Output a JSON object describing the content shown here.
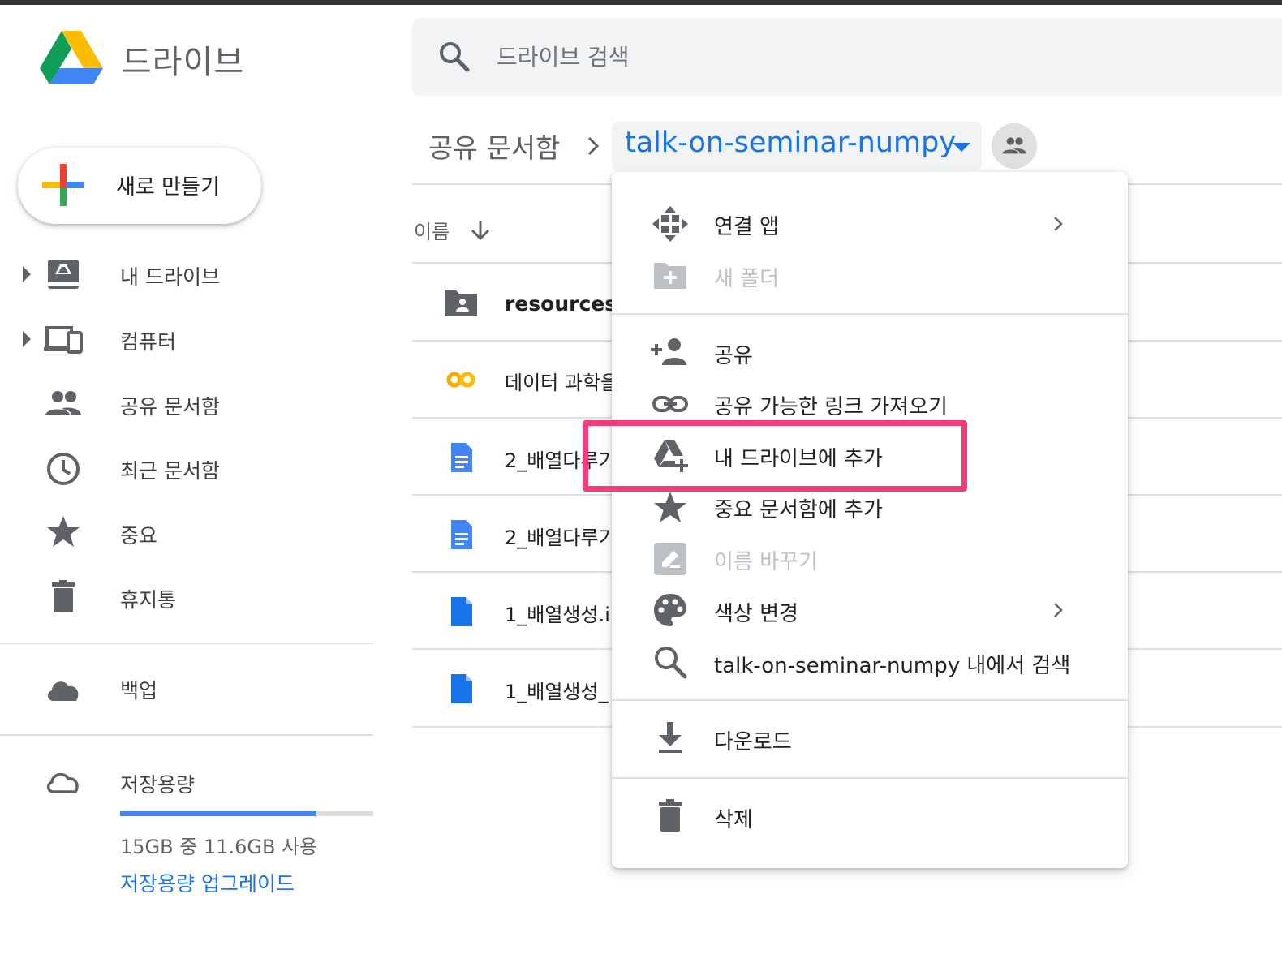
{
  "app": {
    "name": "드라이브"
  },
  "search": {
    "placeholder": "드라이브 검색"
  },
  "new_button": {
    "label": "새로 만들기"
  },
  "sidebar": {
    "items": [
      {
        "label": "내 드라이브",
        "icon": "my-drive-icon"
      },
      {
        "label": "컴퓨터",
        "icon": "computers-icon"
      },
      {
        "label": "공유 문서함",
        "icon": "shared-people-icon"
      },
      {
        "label": "최근 문서함",
        "icon": "clock-icon"
      },
      {
        "label": "중요",
        "icon": "star-icon"
      },
      {
        "label": "휴지통",
        "icon": "trash-icon"
      }
    ],
    "backup": {
      "label": "백업",
      "icon": "cloud-icon"
    },
    "storage": {
      "label": "저장용량",
      "icon": "cloud-outline-icon",
      "used_fraction": 0.773,
      "usage_text": "15GB 중 11.6GB 사용",
      "upgrade_label": "저장용량 업그레이드"
    }
  },
  "breadcrumb": {
    "root": "공유 문서함",
    "current": "talk-on-seminar-numpy"
  },
  "file_list": {
    "column_name": "이름",
    "files": [
      {
        "name": "resources",
        "type": "shared-folder"
      },
      {
        "name": "데이터 과학을",
        "type": "colab"
      },
      {
        "name": "2_배열다루기",
        "type": "doc"
      },
      {
        "name": "2_배열다루기",
        "type": "doc"
      },
      {
        "name": "1_배열생성.i",
        "type": "file"
      },
      {
        "name": "1_배열생성_",
        "type": "file"
      }
    ]
  },
  "context_menu": {
    "items": [
      {
        "label": "연결 앱",
        "icon": "connected-apps-icon",
        "submenu": true,
        "disabled": false
      },
      {
        "label": "새 폴더",
        "icon": "new-folder-icon",
        "submenu": false,
        "disabled": true
      },
      {
        "label": "공유",
        "icon": "person-add-icon",
        "submenu": false,
        "disabled": false
      },
      {
        "label": "공유 가능한 링크 가져오기",
        "icon": "link-icon",
        "submenu": false,
        "disabled": false
      },
      {
        "label": "내 드라이브에 추가",
        "icon": "drive-add-icon",
        "submenu": false,
        "disabled": false
      },
      {
        "label": "중요 문서함에 추가",
        "icon": "star-icon",
        "submenu": false,
        "disabled": false
      },
      {
        "label": "이름 바꾸기",
        "icon": "rename-icon",
        "submenu": false,
        "disabled": true
      },
      {
        "label": "색상 변경",
        "icon": "palette-icon",
        "submenu": true,
        "disabled": false
      },
      {
        "label": "talk-on-seminar-numpy 내에서 검색",
        "icon": "search-icon",
        "submenu": false,
        "disabled": false
      },
      {
        "label": "다운로드",
        "icon": "download-icon",
        "submenu": false,
        "disabled": false
      },
      {
        "label": "삭제",
        "icon": "trash-icon",
        "submenu": false,
        "disabled": false
      }
    ],
    "highlighted_index": 4
  },
  "colors": {
    "accent_blue": "#1a73e8",
    "highlight_pink": "#f33c7a",
    "icon_gray": "#5f6368"
  }
}
